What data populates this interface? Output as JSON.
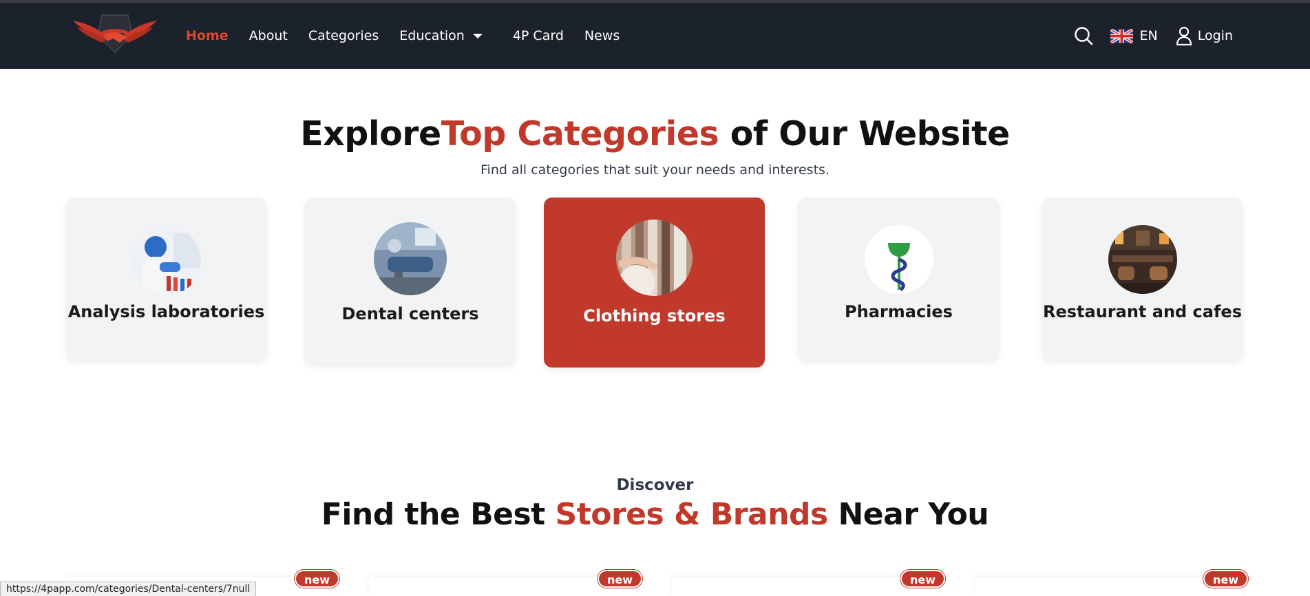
{
  "nav": {
    "links": [
      {
        "label": "Home"
      },
      {
        "label": "About"
      },
      {
        "label": "Categories"
      },
      {
        "label": "Education"
      },
      {
        "label": "4P Card"
      },
      {
        "label": "News"
      }
    ],
    "lang_label": "EN",
    "login_label": "Login"
  },
  "hero": {
    "title_prefix": "Explore",
    "title_accent": "Top Categories",
    "title_suffix": " of Our Website",
    "subtitle": "Find all categories that suit your needs and interests."
  },
  "categories": [
    {
      "label": "Analysis laboratories",
      "icon": "lab-photo"
    },
    {
      "label": "Dental centers",
      "icon": "dental-photo"
    },
    {
      "label": "Clothing stores",
      "icon": "clothing-photo",
      "active": true
    },
    {
      "label": "Pharmacies",
      "icon": "pharmacy-logo"
    },
    {
      "label": "Restaurant and cafes",
      "icon": "restaurant-photo"
    }
  ],
  "discover": {
    "kicker": "Discover",
    "title_prefix": "Find the Best ",
    "title_accent": "Stores & Brands",
    "title_suffix": " Near You"
  },
  "store_badges": [
    "new",
    "new",
    "new",
    "new"
  ],
  "status_url": "https://4papp.com/categories/Dental-centers/7null",
  "colors": {
    "nav_bg": "#1c222c",
    "accent": "#c0392b",
    "active_link": "#e0442f",
    "card_bg": "#f2f3f5"
  }
}
